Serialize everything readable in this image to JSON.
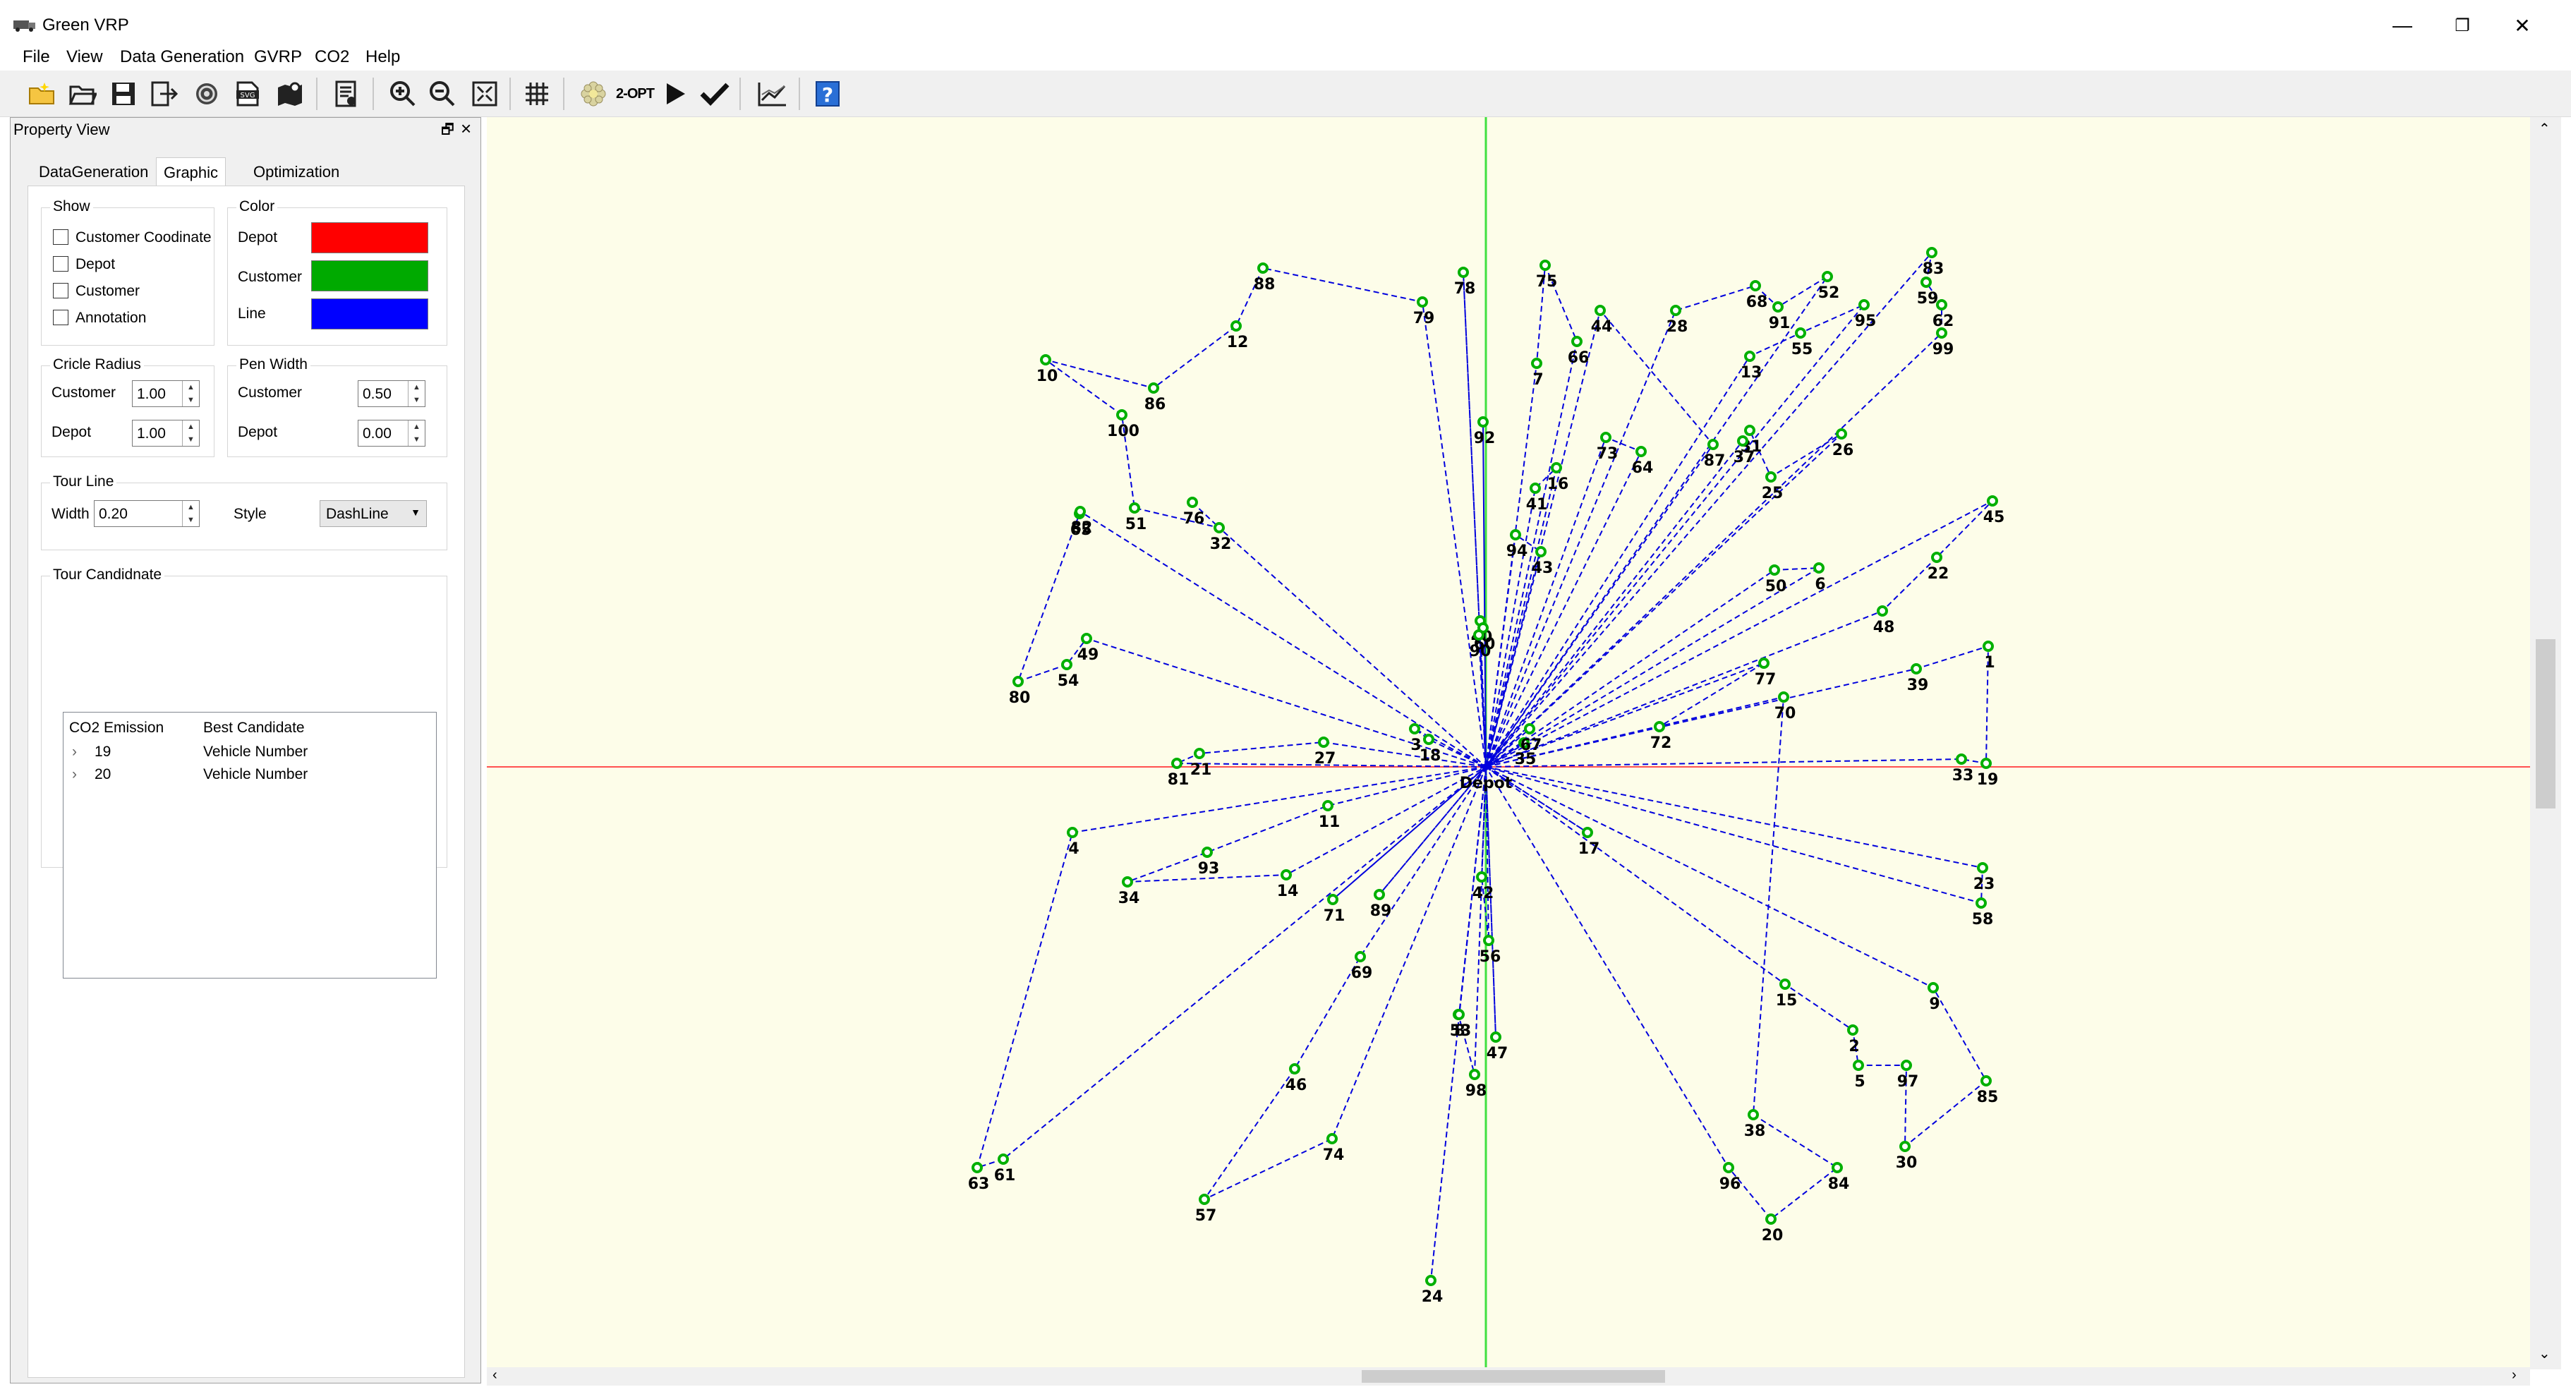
{
  "window": {
    "title": "Green VRP"
  },
  "menu": {
    "items": [
      "File",
      "View",
      "Data Generation",
      "GVRP",
      "CO2",
      "Help"
    ]
  },
  "toolbar": {
    "two_opt_label": "2-OPT"
  },
  "dock": {
    "title": "Property View",
    "tabs": [
      "DataGeneration",
      "Graphic",
      "Optimization"
    ],
    "active_tab": "Graphic",
    "show": {
      "title": "Show",
      "items": [
        "Customer Coodinate",
        "Depot",
        "Customer",
        "Annotation"
      ]
    },
    "color": {
      "title": "Color",
      "items": [
        {
          "label": "Depot",
          "color": "#ff0000"
        },
        {
          "label": "Customer",
          "color": "#00aa00"
        },
        {
          "label": "Line",
          "color": "#0000ff"
        }
      ]
    },
    "circle_radius": {
      "title": "Cricle Radius",
      "customer_label": "Customer",
      "customer_value": "1.00",
      "depot_label": "Depot",
      "depot_value": "1.00"
    },
    "pen_width": {
      "title": "Pen Width",
      "customer_label": "Customer",
      "customer_value": "0.50",
      "depot_label": "Depot",
      "depot_value": "0.00"
    },
    "tour_line": {
      "title": "Tour Line",
      "width_label": "Width",
      "width_value": "0.20",
      "style_label": "Style",
      "style_value": "DashLine"
    },
    "tour_candidate": {
      "title": "Tour Candidnate",
      "col1": "CO2 Emission",
      "col2": "Best Candidate",
      "rows": [
        {
          "emission": "19",
          "candidate": "Vehicle Number"
        },
        {
          "emission": "20",
          "candidate": "Vehicle Number"
        }
      ]
    }
  },
  "plot": {
    "depot_label": "Depot",
    "colors": {
      "background": "#fdfde9",
      "axis_x": "#ff5050",
      "axis_y": "#40e040",
      "route": "#0000dd",
      "customer": "#00b000"
    },
    "node_ids": [
      1,
      2,
      3,
      4,
      5,
      6,
      7,
      8,
      9,
      10,
      11,
      12,
      13,
      14,
      15,
      16,
      17,
      18,
      19,
      20,
      21,
      22,
      23,
      24,
      25,
      26,
      27,
      28,
      30,
      31,
      32,
      33,
      34,
      35,
      37,
      38,
      39,
      40,
      41,
      42,
      43,
      44,
      45,
      46,
      47,
      48,
      49,
      50,
      51,
      52,
      53,
      54,
      55,
      56,
      57,
      58,
      59,
      60,
      61,
      62,
      63,
      64,
      65,
      66,
      67,
      68,
      69,
      70,
      71,
      72,
      73,
      74,
      75,
      76,
      77,
      78,
      79,
      80,
      81,
      82,
      83,
      84,
      85,
      86,
      87,
      88,
      89,
      90,
      91,
      92,
      93,
      94,
      95,
      96,
      97,
      98,
      99,
      100
    ]
  }
}
